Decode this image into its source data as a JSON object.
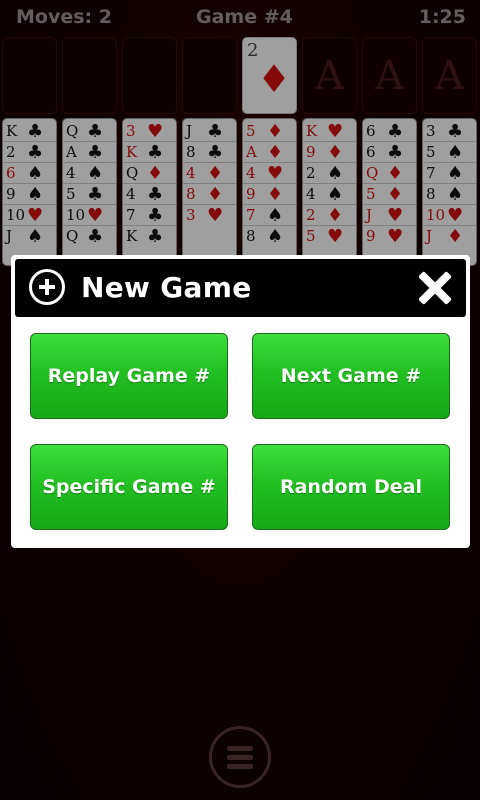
{
  "header": {
    "moves": "Moves: 2",
    "game": "Game #4",
    "time": "1:25"
  },
  "foundation_card": {
    "rank": "2",
    "suit": "♦"
  },
  "foundations": [
    "A",
    "A",
    "A"
  ],
  "columns": [
    {
      "ranks": [
        [
          "K",
          "b"
        ],
        [
          "2",
          "b"
        ],
        [
          "6",
          "r"
        ],
        [
          "9",
          "b"
        ],
        [
          "10",
          "b"
        ],
        [
          "J",
          "b"
        ]
      ],
      "pips": [
        [
          "♣",
          "b"
        ],
        [
          "♣",
          "b"
        ],
        [
          "♠",
          "b"
        ],
        [
          "♠",
          "b"
        ],
        [
          "♥",
          "r"
        ],
        [
          "♠",
          "b"
        ]
      ]
    },
    {
      "ranks": [
        [
          "Q",
          "b"
        ],
        [
          "A",
          "b"
        ],
        [
          "4",
          "b"
        ],
        [
          "5",
          "b"
        ],
        [
          "10",
          "b"
        ],
        [
          "Q",
          "b"
        ]
      ],
      "pips": [
        [
          "♣",
          "b"
        ],
        [
          "♣",
          "b"
        ],
        [
          "♠",
          "b"
        ],
        [
          "♣",
          "b"
        ],
        [
          "♥",
          "r"
        ],
        [
          "♣",
          "b"
        ]
      ]
    },
    {
      "ranks": [
        [
          "3",
          "r"
        ],
        [
          "K",
          "r"
        ],
        [
          "Q",
          "b"
        ],
        [
          "4",
          "b"
        ],
        [
          "7",
          "b"
        ],
        [
          "K",
          "b"
        ]
      ],
      "pips": [
        [
          "♥",
          "r"
        ],
        [
          "♣",
          "b"
        ],
        [
          "♦",
          "r"
        ],
        [
          "♣",
          "b"
        ],
        [
          "♣",
          "b"
        ],
        [
          "♣",
          "b"
        ]
      ]
    },
    {
      "ranks": [
        [
          "J",
          "b"
        ],
        [
          "8",
          "b"
        ],
        [
          "4",
          "r"
        ],
        [
          "8",
          "r"
        ],
        [
          "3",
          "r"
        ]
      ],
      "pips": [
        [
          "♣",
          "b"
        ],
        [
          "♣",
          "b"
        ],
        [
          "♦",
          "r"
        ],
        [
          "♦",
          "r"
        ],
        [
          "♥",
          "r"
        ]
      ]
    },
    {
      "ranks": [
        [
          "5",
          "r"
        ],
        [
          "A",
          "r"
        ],
        [
          "4",
          "r"
        ],
        [
          "9",
          "r"
        ],
        [
          "7",
          "r"
        ],
        [
          "8",
          "b"
        ]
      ],
      "pips": [
        [
          "♦",
          "r"
        ],
        [
          "♦",
          "r"
        ],
        [
          "♥",
          "r"
        ],
        [
          "♦",
          "r"
        ],
        [
          "♠",
          "b"
        ],
        [
          "♠",
          "b"
        ]
      ]
    },
    {
      "ranks": [
        [
          "K",
          "r"
        ],
        [
          "9",
          "r"
        ],
        [
          "2",
          "b"
        ],
        [
          "4",
          "b"
        ],
        [
          "2",
          "r"
        ],
        [
          "5",
          "r"
        ]
      ],
      "pips": [
        [
          "♥",
          "r"
        ],
        [
          "♦",
          "r"
        ],
        [
          "♠",
          "b"
        ],
        [
          "♠",
          "b"
        ],
        [
          "♦",
          "r"
        ],
        [
          "♥",
          "r"
        ]
      ]
    },
    {
      "ranks": [
        [
          "6",
          "b"
        ],
        [
          "6",
          "b"
        ],
        [
          "Q",
          "r"
        ],
        [
          "5",
          "r"
        ],
        [
          "J",
          "r"
        ],
        [
          "9",
          "r"
        ]
      ],
      "pips": [
        [
          "♣",
          "b"
        ],
        [
          "♣",
          "b"
        ],
        [
          "♦",
          "r"
        ],
        [
          "♦",
          "r"
        ],
        [
          "♥",
          "r"
        ],
        [
          "♥",
          "r"
        ]
      ]
    },
    {
      "ranks": [
        [
          "3",
          "b"
        ],
        [
          "5",
          "b"
        ],
        [
          "7",
          "b"
        ],
        [
          "8",
          "b"
        ],
        [
          "10",
          "r"
        ],
        [
          "J",
          "r"
        ]
      ],
      "pips": [
        [
          "♣",
          "b"
        ],
        [
          "♠",
          "b"
        ],
        [
          "♠",
          "b"
        ],
        [
          "♠",
          "b"
        ],
        [
          "♥",
          "r"
        ],
        [
          "♦",
          "r"
        ]
      ]
    }
  ],
  "dialog": {
    "title": "New Game",
    "buttons": {
      "replay": "Replay Game #",
      "next": "Next Game #",
      "specific": "Specific Game #",
      "random": "Random Deal"
    }
  },
  "colors": {
    "button_green": "#22c022",
    "card_red": "#cc1010",
    "background": "#1a0303"
  },
  "icons": {
    "dialog": "plus-circle-icon",
    "close": "close-icon",
    "menu": "hamburger-menu-icon"
  }
}
